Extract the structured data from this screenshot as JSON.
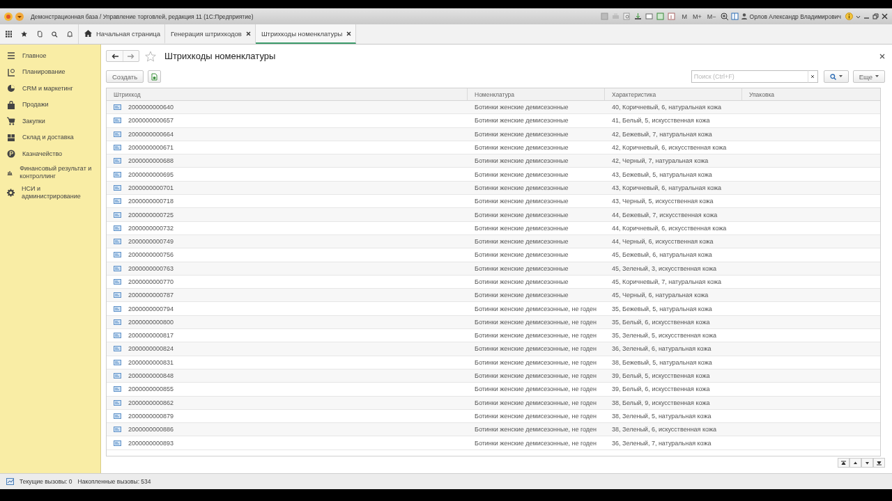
{
  "window": {
    "title": "Демонстрационная база / Управление торговлей, редакция 11  (1С:Предприятие)",
    "memory_buttons": [
      "M",
      "M+",
      "M−"
    ],
    "user": "Орлов Александр Владимирович"
  },
  "tabs": [
    {
      "label": "Начальная страница",
      "selected": false,
      "closable": false
    },
    {
      "label": "Генерация штрихкодов",
      "selected": false,
      "closable": true
    },
    {
      "label": "Штрихкоды номенклатуры",
      "selected": true,
      "closable": true
    }
  ],
  "sidebar": {
    "items": [
      {
        "label": "Главное"
      },
      {
        "label": "Планирование"
      },
      {
        "label": "CRM и маркетинг"
      },
      {
        "label": "Продажи"
      },
      {
        "label": "Закупки"
      },
      {
        "label": "Склад и доставка"
      },
      {
        "label": "Казначейство"
      },
      {
        "label": "Финансовый результат и контроллинг"
      },
      {
        "label": "НСИ и администрирование"
      }
    ]
  },
  "form": {
    "title": "Штрихкоды номенклатуры",
    "create_button": "Создать",
    "search": {
      "placeholder": "Поиск (Ctrl+F)"
    },
    "more_button": "Еще"
  },
  "table": {
    "columns": [
      "Штрихкод",
      "Номенклатура",
      "Характеристика",
      "Упаковка"
    ],
    "rows": [
      {
        "barcode": "2000000000640",
        "item": "Ботинки женские демисезонные",
        "characteristic": "40, Коричневый, 6, натуральная кожа"
      },
      {
        "barcode": "2000000000657",
        "item": "Ботинки женские демисезонные",
        "characteristic": "41, Белый, 5, искусственная кожа"
      },
      {
        "barcode": "2000000000664",
        "item": "Ботинки женские демисезонные",
        "characteristic": "42, Бежевый, 7, натуральная кожа"
      },
      {
        "barcode": "2000000000671",
        "item": "Ботинки женские демисезонные",
        "characteristic": "42, Коричневый, 6, искусственная кожа"
      },
      {
        "barcode": "2000000000688",
        "item": "Ботинки женские демисезонные",
        "characteristic": "42, Черный, 7, натуральная кожа"
      },
      {
        "barcode": "2000000000695",
        "item": "Ботинки женские демисезонные",
        "characteristic": "43, Бежевый, 5, натуральная кожа"
      },
      {
        "barcode": "2000000000701",
        "item": "Ботинки женские демисезонные",
        "characteristic": "43, Коричневый, 6, натуральная кожа"
      },
      {
        "barcode": "2000000000718",
        "item": "Ботинки женские демисезонные",
        "characteristic": "43, Черный, 5, искусственная кожа"
      },
      {
        "barcode": "2000000000725",
        "item": "Ботинки женские демисезонные",
        "characteristic": "44, Бежевый, 7, искусственная кожа"
      },
      {
        "barcode": "2000000000732",
        "item": "Ботинки женские демисезонные",
        "characteristic": "44, Коричневый, 6, искусственная кожа"
      },
      {
        "barcode": "2000000000749",
        "item": "Ботинки женские демисезонные",
        "characteristic": "44, Черный, 6, искусственная кожа"
      },
      {
        "barcode": "2000000000756",
        "item": "Ботинки женские демисезонные",
        "characteristic": "45, Бежевый, 6, натуральная кожа"
      },
      {
        "barcode": "2000000000763",
        "item": "Ботинки женские демисезонные",
        "characteristic": "45, Зеленый, 3, искусственная кожа"
      },
      {
        "barcode": "2000000000770",
        "item": "Ботинки женские демисезонные",
        "characteristic": "45, Коричневый, 7, натуральная кожа"
      },
      {
        "barcode": "2000000000787",
        "item": "Ботинки женские демисезонные",
        "characteristic": "45, Черный, 6, натуральная кожа"
      },
      {
        "barcode": "2000000000794",
        "item": "Ботинки женские демисезонные, не годен",
        "characteristic": "35, Бежевый, 5, натуральная кожа"
      },
      {
        "barcode": "2000000000800",
        "item": "Ботинки женские демисезонные, не годен",
        "characteristic": "35, Белый, 6, искусственная кожа"
      },
      {
        "barcode": "2000000000817",
        "item": "Ботинки женские демисезонные, не годен",
        "characteristic": "35, Зеленый, 5, искусственная кожа"
      },
      {
        "barcode": "2000000000824",
        "item": "Ботинки женские демисезонные, не годен",
        "characteristic": "36, Зеленый, 6, натуральная кожа"
      },
      {
        "barcode": "2000000000831",
        "item": "Ботинки женские демисезонные, не годен",
        "characteristic": "38, Бежевый, 5, натуральная кожа"
      },
      {
        "barcode": "2000000000848",
        "item": "Ботинки женские демисезонные, не годен",
        "characteristic": "39, Белый, 5, искусственная кожа"
      },
      {
        "barcode": "2000000000855",
        "item": "Ботинки женские демисезонные, не годен",
        "characteristic": "39, Белый, 6, искусственная кожа"
      },
      {
        "barcode": "2000000000862",
        "item": "Ботинки женские демисезонные, не годен",
        "characteristic": "38, Белый, 9, искусственная кожа"
      },
      {
        "barcode": "2000000000879",
        "item": "Ботинки женские демисезонные, не годен",
        "characteristic": "38, Зеленый, 5, натуральная кожа"
      },
      {
        "barcode": "2000000000886",
        "item": "Ботинки женские демисезонные, не годен",
        "characteristic": "38, Зеленый, 6, искусственная кожа"
      },
      {
        "barcode": "2000000000893",
        "item": "Ботинки женские демисезонные, не годен",
        "characteristic": "36, Зеленый, 7, натуральная кожа"
      }
    ]
  },
  "status_bar": {
    "current_calls": "Текущие вызовы: 0",
    "accumulated_calls": "Накопленные вызовы: 534"
  }
}
